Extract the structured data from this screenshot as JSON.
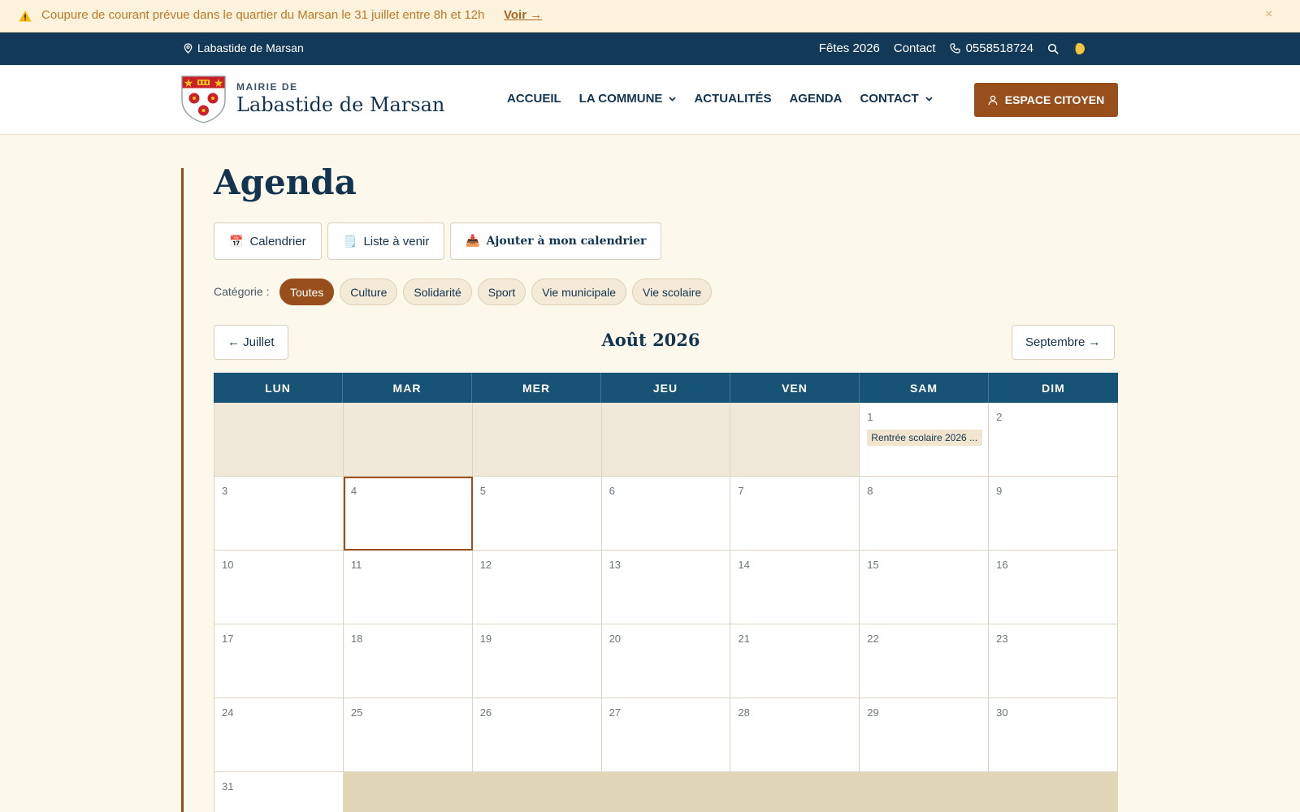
{
  "alert": {
    "message": "Coupure de courant prévue dans le quartier du Marsan le 31 juillet entre 8h et 12h",
    "link_label": "Voir →",
    "close_label": "×"
  },
  "topbar": {
    "location": "Labastide de Marsan",
    "links": [
      "Fêtes 2026",
      "Contact"
    ],
    "phone": "0558518724"
  },
  "header": {
    "prefix": "MAIRIE DE",
    "site_name": "Labastide de Marsan",
    "nav": [
      {
        "label": "ACCUEIL",
        "dropdown": false
      },
      {
        "label": "LA COMMUNE",
        "dropdown": true
      },
      {
        "label": "ACTUALITÉS",
        "dropdown": false
      },
      {
        "label": "AGENDA",
        "dropdown": false
      },
      {
        "label": "CONTACT",
        "dropdown": true
      }
    ],
    "citizen_button": "ESPACE CITOYEN"
  },
  "page": {
    "title": "Agenda",
    "views": [
      {
        "icon": "📅",
        "label": "Calendrier"
      },
      {
        "icon": "🗒️",
        "label": "Liste à venir"
      },
      {
        "icon": "📥",
        "label": "Ajouter à mon calendrier"
      }
    ],
    "category_label": "Catégorie :",
    "categories": [
      "Toutes",
      "Culture",
      "Solidarité",
      "Sport",
      "Vie municipale",
      "Vie scolaire"
    ],
    "active_category": "Toutes"
  },
  "calendar": {
    "prev_label": "← Juillet",
    "next_label": "Septembre →",
    "month_title": "Août 2026",
    "weekdays": [
      "LUN",
      "MAR",
      "MER",
      "JEU",
      "VEN",
      "SAM",
      "DIM"
    ],
    "leading_empty": 5,
    "days_in_month": 31,
    "today": 4,
    "events": [
      {
        "day": 1,
        "title": "Rentrée scolaire 2026 ..."
      }
    ]
  },
  "colors": {
    "primary": "#12344e",
    "accent": "#984f1c",
    "calendar_header": "#165375",
    "background": "#fdf8ec"
  }
}
